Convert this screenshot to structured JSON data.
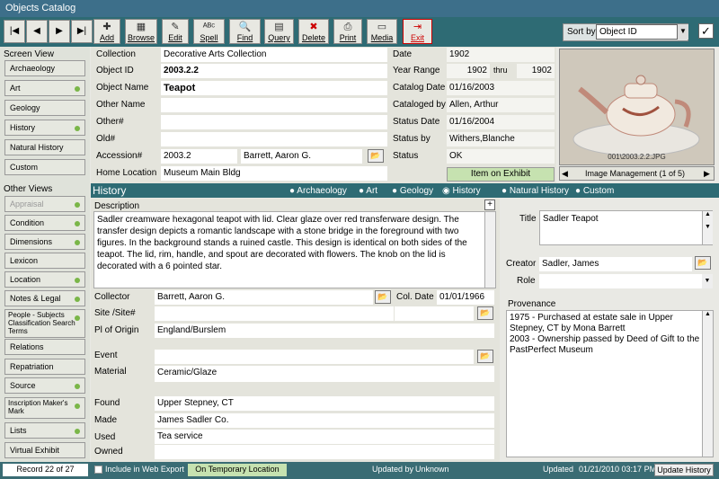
{
  "window": {
    "title": "Objects Catalog"
  },
  "toolbar": {
    "nav": [
      {
        "icon": "first-record-icon",
        "glyph": "|◀"
      },
      {
        "icon": "prev-record-icon",
        "glyph": "◀"
      },
      {
        "icon": "next-record-icon",
        "glyph": "▶"
      },
      {
        "icon": "last-record-icon",
        "glyph": "▶|"
      }
    ],
    "buttons": [
      {
        "label": "Add",
        "icon": "add-icon",
        "glyph": "✚"
      },
      {
        "label": "Browse",
        "icon": "browse-icon",
        "glyph": "▦"
      },
      {
        "label": "Edit",
        "icon": "edit-icon",
        "glyph": "✎"
      },
      {
        "label": "Spell",
        "icon": "spell-icon",
        "glyph": "ᴬᴮᶜ"
      },
      {
        "label": "Find",
        "icon": "find-icon",
        "glyph": "🔍"
      },
      {
        "label": "Query",
        "icon": "query-icon",
        "glyph": "▤"
      },
      {
        "label": "Delete",
        "icon": "delete-icon",
        "glyph": "✖"
      },
      {
        "label": "Print",
        "icon": "print-icon",
        "glyph": "⎙"
      },
      {
        "label": "Media",
        "icon": "media-icon",
        "glyph": "▭"
      },
      {
        "label": "Exit",
        "icon": "exit-icon",
        "glyph": "⇥"
      }
    ],
    "sort_label": "Sort by",
    "sort_value": "Object ID"
  },
  "left": {
    "screen_view_title": "Screen View",
    "screen_views": [
      {
        "label": "Archaeology",
        "dot": false
      },
      {
        "label": "Art",
        "dot": true
      },
      {
        "label": "Geology",
        "dot": false
      },
      {
        "label": "History",
        "dot": true
      },
      {
        "label": "Natural History",
        "dot": false
      },
      {
        "label": "Custom",
        "dot": false
      }
    ],
    "other_views_title": "Other Views",
    "other_views": [
      {
        "label": "Appraisal",
        "dot": true
      },
      {
        "label": "Condition",
        "dot": true
      },
      {
        "label": "Dimensions",
        "dot": true
      },
      {
        "label": "Lexicon",
        "dot": false
      },
      {
        "label": "Location",
        "dot": true
      },
      {
        "label": "Notes & Legal",
        "dot": true
      },
      {
        "label": "People - Subjects Classification Search Terms",
        "dot": true
      },
      {
        "label": "Relations",
        "dot": false
      },
      {
        "label": "Repatriation",
        "dot": false
      },
      {
        "label": "Source",
        "dot": true
      },
      {
        "label": "Inscription Maker's Mark",
        "dot": true
      },
      {
        "label": "Lists",
        "dot": true
      },
      {
        "label": "Virtual Exhibit",
        "dot": false
      }
    ]
  },
  "record": {
    "collection_label": "Collection",
    "collection": "Decorative Arts Collection",
    "objectid_label": "Object ID",
    "objectid": "2003.2.2",
    "objectname_label": "Object Name",
    "objectname": "Teapot",
    "othername_label": "Other Name",
    "othernum_label": "Other#",
    "oldnum_label": "Old#",
    "accession_label": "Accession#",
    "accession": "2003.2",
    "accession_person": "Barrett, Aaron G.",
    "homeloc_label": "Home Location",
    "homeloc": "Museum Main Bldg",
    "date_label": "Date",
    "date": "1902",
    "yearrange_label": "Year Range",
    "year_from": "1902",
    "thru_label": "thru",
    "year_to": "1902",
    "catdate_label": "Catalog Date",
    "catdate": "01/16/2003",
    "catby_label": "Cataloged by",
    "catby": "Allen, Arthur",
    "statusdate_label": "Status Date",
    "statusdate": "01/16/2004",
    "statusby_label": "Status by",
    "statusby": "Withers,Blanche",
    "status_label": "Status",
    "status": "OK",
    "exhibit": "Item on Exhibit",
    "image_caption": "001\\2003.2.2.JPG",
    "image_mgmt": "Image Management (1 of 5)"
  },
  "history": {
    "title": "History",
    "radios": [
      {
        "label": "Archaeology",
        "on": false
      },
      {
        "label": "Art",
        "on": false
      },
      {
        "label": "Geology",
        "on": false
      },
      {
        "label": "History",
        "on": true
      },
      {
        "label": "Natural History",
        "on": false
      },
      {
        "label": "Custom",
        "on": false
      }
    ],
    "desc_label": "Description",
    "description": "Sadler creamware hexagonal teapot with lid. Clear glaze over red transferware design. The transfer design depicts a romantic landscape with a stone bridge in the foreground with two figures. In the background stands a ruined castle. This design is identical on both sides of the teapot. The lid, rim, handle, and spout are decorated with flowers. The knob on the lid is decorated with a 6 pointed star.",
    "collector_label": "Collector",
    "collector": "Barrett, Aaron G.",
    "coldate_label": "Col. Date",
    "coldate": "01/01/1966",
    "site_label": "Site /Site#",
    "origin_label": "Pl of Origin",
    "origin": "England/Burslem",
    "event_label": "Event",
    "material_label": "Material",
    "material": "Ceramic/Glaze",
    "found_label": "Found",
    "found": "Upper Stepney, CT",
    "made_label": "Made",
    "made": "James Sadler Co.",
    "used_label": "Used",
    "used": "Tea service",
    "owned_label": "Owned",
    "title_label": "Title",
    "title_val": "Sadler Teapot",
    "creator_label": "Creator",
    "creator": "Sadler, James",
    "role_label": "Role",
    "prov_label": "Provenance",
    "provenance": "1975 - Purchased at estate sale in Upper Stepney, CT by Mona Barrett\n2003 - Ownership passed by Deed of Gift to the PastPerfect Museum"
  },
  "status": {
    "record": "Record 22 of 27",
    "web": "Include in Web Export",
    "location": "On Temporary Location",
    "updated_by_label": "Updated by",
    "updated_by": "Unknown",
    "updated_label": "Updated",
    "updated": "01/21/2010 03:17 PM",
    "update_history": "Update History"
  },
  "colors": {
    "teal": "#2e6b74",
    "green": "#7ab648",
    "exhibit_bg": "#c6e2b0"
  }
}
